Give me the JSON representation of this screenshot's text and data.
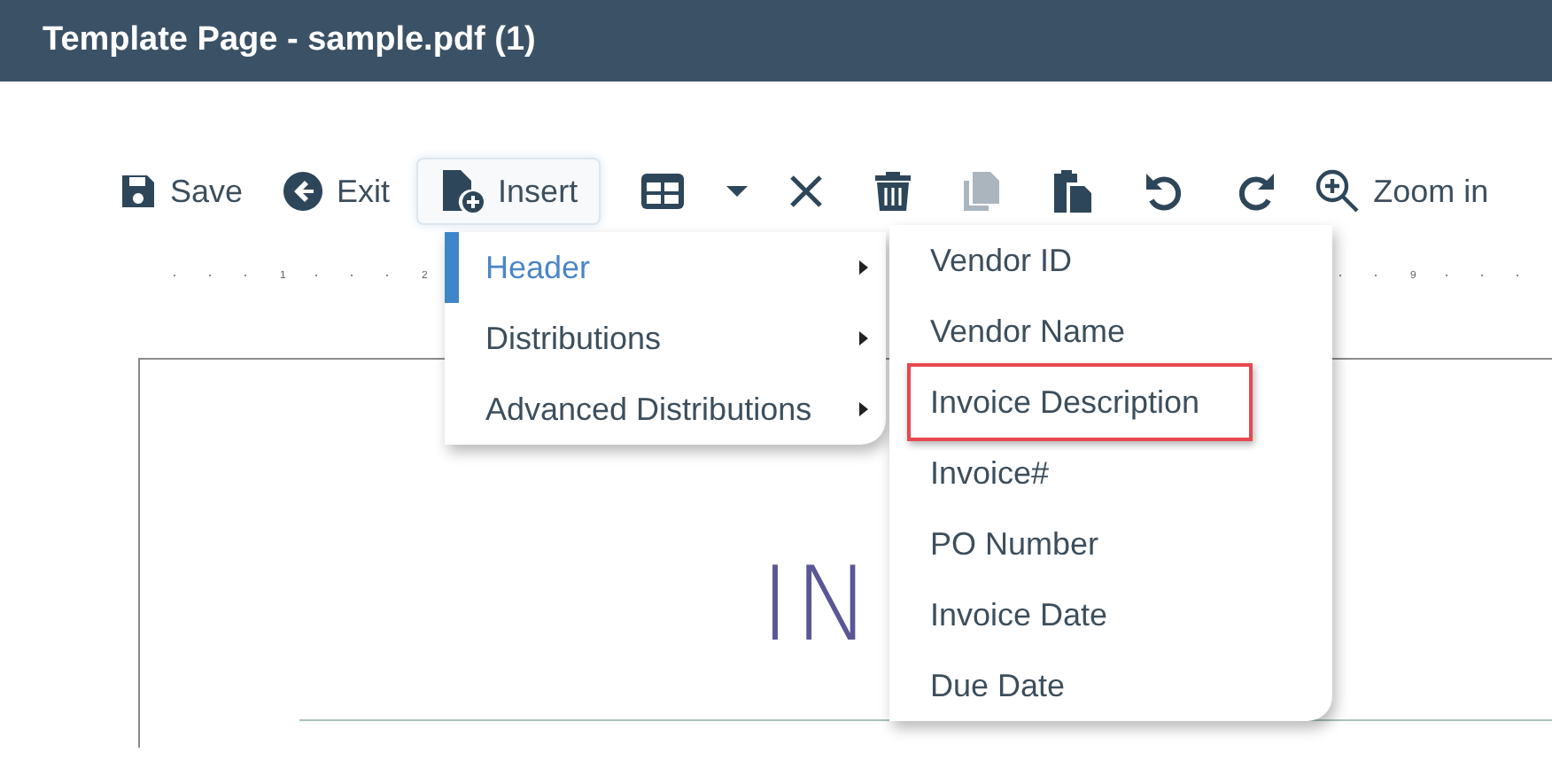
{
  "window": {
    "title": "Template Page - sample.pdf (1)"
  },
  "toolbar": [
    {
      "kind": "button",
      "label": "Save",
      "active": false,
      "disabled": false
    },
    {
      "kind": "button",
      "label": "Exit",
      "active": false,
      "disabled": false
    },
    {
      "kind": "button",
      "label": "Insert",
      "active": true,
      "disabled": false
    },
    {
      "kind": "icon",
      "active": false,
      "disabled": false
    },
    {
      "kind": "caret",
      "active": false,
      "disabled": false
    },
    {
      "kind": "icon",
      "active": false,
      "disabled": false
    },
    {
      "kind": "icon",
      "active": false,
      "disabled": false
    },
    {
      "kind": "icon",
      "active": false,
      "disabled": true
    },
    {
      "kind": "icon",
      "active": false,
      "disabled": false
    },
    {
      "kind": "icon",
      "active": false,
      "disabled": false
    },
    {
      "kind": "icon",
      "active": false,
      "disabled": false
    },
    {
      "kind": "button",
      "label": "Zoom in",
      "active": false,
      "disabled": false
    }
  ],
  "ruler": {
    "labels": [
      "1",
      "2",
      "9"
    ]
  },
  "document": {
    "heading": "IN"
  },
  "insert_menu": {
    "items": [
      {
        "label": "Header",
        "selected": true,
        "has_submenu": true
      },
      {
        "label": "Distributions",
        "selected": false,
        "has_submenu": true
      },
      {
        "label": "Advanced Distributions",
        "selected": false,
        "has_submenu": true
      }
    ]
  },
  "submenu": {
    "items": [
      {
        "label": "Vendor ID",
        "highlighted": false
      },
      {
        "label": "Vendor Name",
        "highlighted": false
      },
      {
        "label": "Invoice Description",
        "highlighted": true
      },
      {
        "label": "Invoice#",
        "highlighted": false
      },
      {
        "label": "PO Number",
        "highlighted": false
      },
      {
        "label": "Invoice Date",
        "highlighted": false
      },
      {
        "label": "Due Date",
        "highlighted": false
      }
    ]
  }
}
